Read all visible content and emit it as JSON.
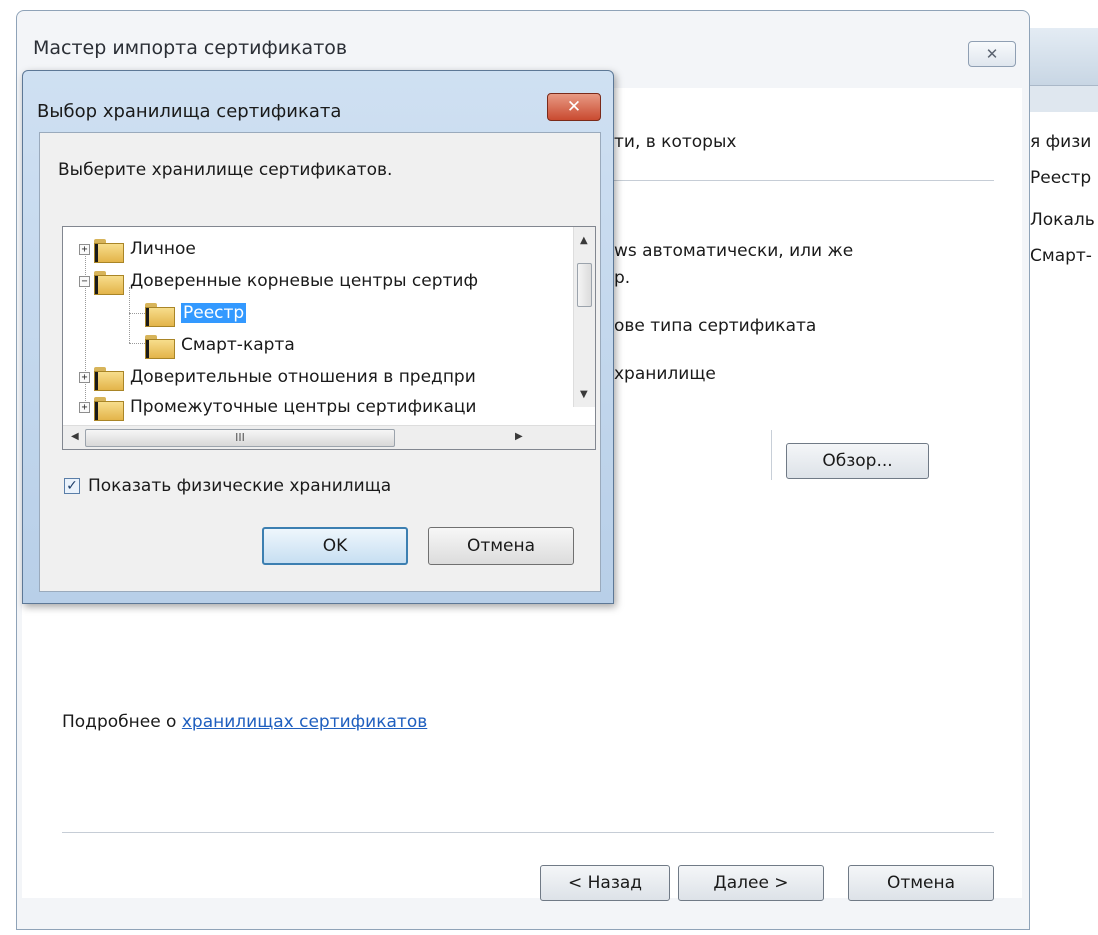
{
  "background_window": {
    "lines": [
      "я физи",
      "Реестр",
      "Локаль",
      "Смарт-"
    ]
  },
  "wizard": {
    "title": "Мастер импорта сертификатов",
    "close_glyph": "✕",
    "text_1": "ти, в которых",
    "text_2": "ws автоматически, или же",
    "text_3": "р.",
    "text_4": "ове типа сертификата",
    "text_5": "хранилище",
    "browse_button": "Обзор...",
    "more_prefix": "Подробнее о ",
    "more_link": "хранилищах сертификатов",
    "back_button": "< Назад",
    "next_button": "Далее >",
    "cancel_button": "Отмена"
  },
  "dialog": {
    "title": "Выбор хранилища сертификата",
    "close_glyph": "✕",
    "prompt": "Выберите хранилище сертификатов.",
    "tree": {
      "items": [
        {
          "label": "Личное",
          "expander": "+"
        },
        {
          "label": "Доверенные корневые центры сертиф",
          "expander": "−"
        },
        {
          "label": "Реестр",
          "selected": true
        },
        {
          "label": "Смарт-карта"
        },
        {
          "label": "Доверительные отношения в предпри",
          "expander": "+"
        },
        {
          "label": "Промежуточные центры сертификаци",
          "expander": "+"
        }
      ],
      "hscroll_grip": "III"
    },
    "show_physical_label": "Показать физические хранилища",
    "show_physical_checked": true,
    "check_glyph": "✓",
    "ok_button": "OK",
    "cancel_button": "Отмена"
  }
}
